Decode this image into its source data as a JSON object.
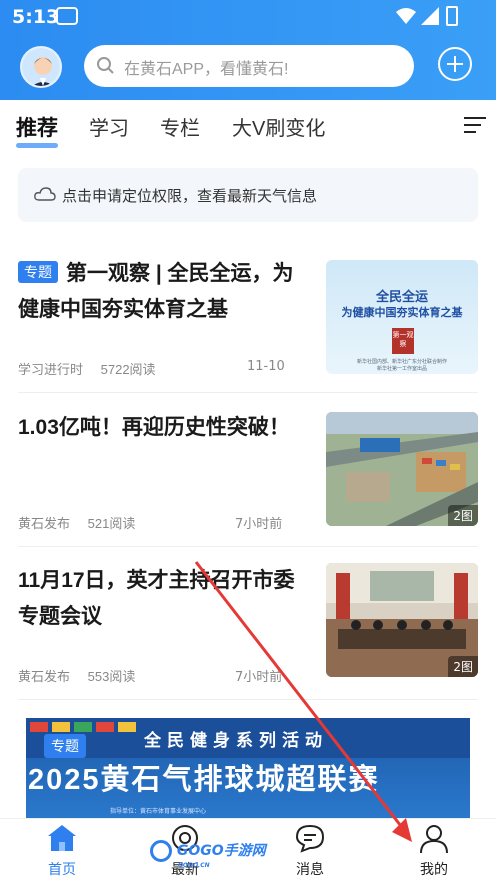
{
  "status": {
    "time": "5:13"
  },
  "header": {
    "search_placeholder": "在黄石APP，看懂黄石!"
  },
  "tabs": [
    {
      "label": "推荐",
      "active": true
    },
    {
      "label": "学习"
    },
    {
      "label": "专栏"
    },
    {
      "label": "大V刷变化"
    }
  ],
  "weather": {
    "text": "点击申请定位权限，查看最新天气信息"
  },
  "articles": [
    {
      "tag": "专题",
      "title": "第一观察 | 全民全运，为健康中国夯实体育之基",
      "source": "学习进行时",
      "reads": "5722阅读",
      "time": "11-10",
      "thumb_title_1": "全民全运",
      "thumb_title_2": "为健康中国夯实体育之基",
      "thumb_seal": "第一观察",
      "thumb_caption_1": "新华社国内部、新华社广东分社联合制作",
      "thumb_caption_2": "新华社第一工作室出品"
    },
    {
      "title": "1.03亿吨！再迎历史性突破！",
      "source": "黄石发布",
      "reads": "521阅读",
      "time": "7小时前",
      "pics": "2图"
    },
    {
      "title": "11月17日，英才主持召开市委专题会议",
      "source": "黄石发布",
      "reads": "553阅读",
      "time": "7小时前",
      "pics": "2图"
    }
  ],
  "banner": {
    "tag": "专题",
    "subtitle": "全民健身系列活动",
    "title": "2025黄石气排球城超联赛",
    "org": "指导单位：黄石市体育事业发展中心"
  },
  "bottom_nav": [
    {
      "label": "首页",
      "active": true
    },
    {
      "label": "最新"
    },
    {
      "label": "消息"
    },
    {
      "label": "我的"
    }
  ],
  "watermark": {
    "text": "GOGO手游网",
    "sub": "GOGO.CN"
  },
  "colors": {
    "primary": "#2f80ee",
    "header": "#2c8cf1",
    "arrow": "#e53935"
  }
}
